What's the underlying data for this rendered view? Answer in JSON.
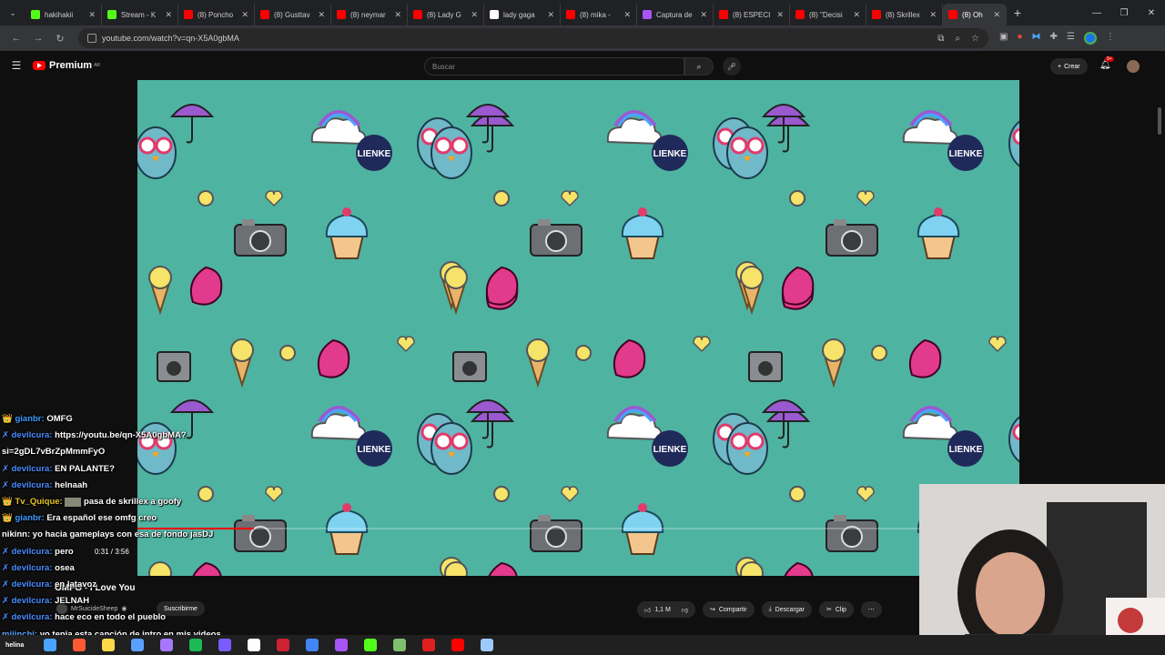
{
  "browser": {
    "tabs": [
      {
        "title": "hakihakii",
        "color": "#53fc18"
      },
      {
        "title": "Stream - K",
        "color": "#53fc18"
      },
      {
        "title": "(8) Poncho",
        "color": "#ff0000"
      },
      {
        "title": "(8) Gusttav",
        "color": "#ff0000"
      },
      {
        "title": "(8) neymar",
        "color": "#ff0000"
      },
      {
        "title": "(8) Lady G",
        "color": "#ff0000"
      },
      {
        "title": "lady gaga",
        "color": "#ffffff"
      },
      {
        "title": "(8) mika -",
        "color": "#ff0000"
      },
      {
        "title": "Captura de",
        "color": "#a855f7"
      },
      {
        "title": "(8) ESPECI",
        "color": "#ff0000"
      },
      {
        "title": "(8) \"Decisi",
        "color": "#ff0000"
      },
      {
        "title": "(8) Skrillex",
        "color": "#ff0000"
      },
      {
        "title": "(8) Oh",
        "color": "#ff0000",
        "active": true
      }
    ],
    "new_tab": "+",
    "url": "youtube.com/watch?v=qn-X5A0gbMA"
  },
  "youtube": {
    "logo_text": "Premium",
    "logo_sup": "AR",
    "search_placeholder": "Buscar",
    "create_label": "Crear",
    "notif_count": "9+"
  },
  "video": {
    "current_time": "0:31 / 3:56",
    "progress_fraction": 0.132,
    "title": "OMFG - I Love You",
    "channel": "MrSuicideSheep",
    "subscribe_label": "Suscribirme",
    "likes": "1,1 M",
    "share_label": "Compartir",
    "download_label": "Descargar",
    "clip_label": "Clip",
    "pattern_sign": "LIENKE"
  },
  "chat": [
    {
      "user": "gianbr:",
      "color": "#3d9bff",
      "msg": "OMFG",
      "badge": "👑"
    },
    {
      "user": "devilcura:",
      "color": "#4b8bff",
      "msg": "https://youtu.be/qn-X5A0gbMA?",
      "badge": "✗"
    },
    {
      "user": "",
      "color": "#fff",
      "msg": "si=2gDL7vBrZpMmmFyO",
      "badge": ""
    },
    {
      "user": "devilcura:",
      "color": "#4b8bff",
      "msg": "EN PALANTE?",
      "badge": "✗"
    },
    {
      "user": "devilcura:",
      "color": "#4b8bff",
      "msg": "helnaah",
      "badge": "✗"
    },
    {
      "user": "Tv_Quique:",
      "color": "#e6c229",
      "msg": "pasa de skrillex a goofy",
      "badge": "👑",
      "emote": true
    },
    {
      "user": "gianbr:",
      "color": "#3d9bff",
      "msg": "Era español ese omfg creo",
      "badge": "👑"
    },
    {
      "user": "nikinn:",
      "color": "#fff",
      "msg": "yo hacia gameplays con esa de fondo jasDJ",
      "badge": ""
    },
    {
      "user": "devilcura:",
      "color": "#4b8bff",
      "msg": "pero",
      "badge": "✗"
    },
    {
      "user": "devilcura:",
      "color": "#4b8bff",
      "msg": "osea",
      "badge": "✗"
    },
    {
      "user": "devilcura:",
      "color": "#4b8bff",
      "msg": "en latavoz",
      "badge": "✗"
    },
    {
      "user": "devilcura:",
      "color": "#4b8bff",
      "msg": "JELNAH",
      "badge": "✗"
    },
    {
      "user": "devilcura:",
      "color": "#4b8bff",
      "msg": "hace eco en todo el pueblo",
      "badge": "✗"
    },
    {
      "user": "miiinchi:",
      "color": "#5aa0ff",
      "msg": "yo tenia esta canción de intro en mis videos",
      "badge": ""
    }
  ],
  "taskbar": {
    "label": "helina",
    "icons": [
      "#4aa3ff",
      "#ff5a36",
      "#ffd84a",
      "#5aa0ff",
      "#a678ff",
      "#1db954",
      "#7a5cff",
      "#ffffff",
      "#cc2233",
      "#4285f4",
      "#a855f7",
      "#53fc18",
      "#7fbf6f",
      "#e02020",
      "#ff0000",
      "#9ec9ff"
    ]
  }
}
